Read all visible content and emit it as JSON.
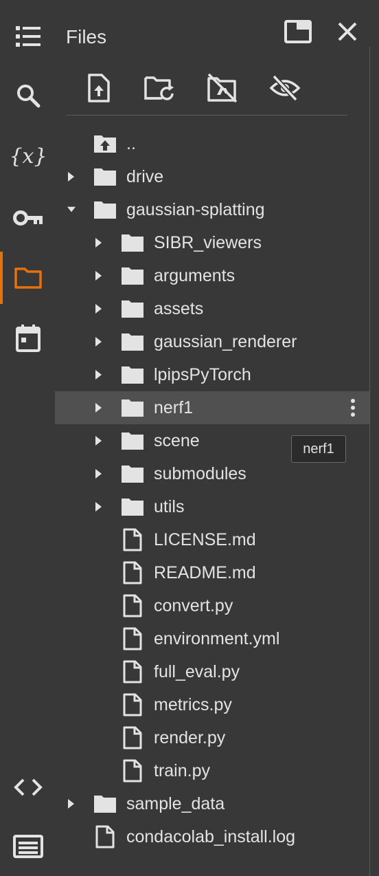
{
  "panel": {
    "title": "Files",
    "accent_color": "#e8710a"
  },
  "rail": {
    "items": [
      {
        "icon": "table-of-contents-icon"
      },
      {
        "icon": "search-icon"
      },
      {
        "icon": "variables-icon",
        "glyph": "{x}"
      },
      {
        "icon": "key-icon"
      },
      {
        "icon": "folder-icon",
        "active": true
      },
      {
        "icon": "calendar-icon"
      },
      {
        "icon": "code-icon"
      },
      {
        "icon": "terminal-icon"
      }
    ]
  },
  "toolbar": {
    "buttons": [
      {
        "icon": "upload-file-icon"
      },
      {
        "icon": "refresh-folder-icon"
      },
      {
        "icon": "unmount-drive-icon"
      },
      {
        "icon": "hide-hidden-files-icon"
      }
    ]
  },
  "tree": {
    "parent": "..",
    "items": [
      {
        "label": "drive",
        "type": "folder",
        "expanded": false
      },
      {
        "label": "gaussian-splatting",
        "type": "folder",
        "expanded": true
      },
      {
        "label": "SIBR_viewers",
        "type": "folder",
        "expanded": false
      },
      {
        "label": "arguments",
        "type": "folder",
        "expanded": false
      },
      {
        "label": "assets",
        "type": "folder",
        "expanded": false
      },
      {
        "label": "gaussian_renderer",
        "type": "folder",
        "expanded": false
      },
      {
        "label": "lpipsPyTorch",
        "type": "folder",
        "expanded": false
      },
      {
        "label": "nerf1",
        "type": "folder",
        "expanded": false,
        "hovered": true
      },
      {
        "label": "scene",
        "type": "folder",
        "expanded": false
      },
      {
        "label": "submodules",
        "type": "folder",
        "expanded": false
      },
      {
        "label": "utils",
        "type": "folder",
        "expanded": false
      },
      {
        "label": "LICENSE.md",
        "type": "file"
      },
      {
        "label": "README.md",
        "type": "file"
      },
      {
        "label": "convert.py",
        "type": "file"
      },
      {
        "label": "environment.yml",
        "type": "file"
      },
      {
        "label": "full_eval.py",
        "type": "file"
      },
      {
        "label": "metrics.py",
        "type": "file"
      },
      {
        "label": "render.py",
        "type": "file"
      },
      {
        "label": "train.py",
        "type": "file"
      },
      {
        "label": "sample_data",
        "type": "folder",
        "expanded": false
      },
      {
        "label": "condacolab_install.log",
        "type": "file"
      }
    ]
  },
  "tooltip": {
    "text": "nerf1"
  }
}
